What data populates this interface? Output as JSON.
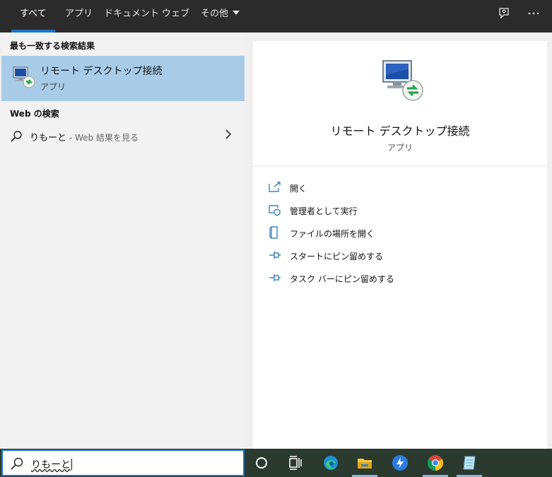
{
  "tabs": [
    {
      "label": "すべて",
      "active": true
    },
    {
      "label": "アプリ",
      "active": false
    },
    {
      "label": "ドキュメント",
      "active": false
    },
    {
      "label": "ウェブ",
      "active": false
    },
    {
      "label": "その他",
      "active": false
    }
  ],
  "topbar_icons": [
    "feedback-icon",
    "more-options-icon"
  ],
  "best_match": {
    "header": "最も一致する検索結果",
    "title": "リモート デスクトップ接続",
    "subtitle": "アプリ",
    "icon": "remote-desktop-icon"
  },
  "web_search": {
    "header": "Web の検索",
    "query": "りもーと",
    "suffix": " - Web 結果を見る"
  },
  "detail": {
    "title": "リモート デスクトップ接続",
    "subtitle": "アプリ",
    "actions": [
      {
        "label": "開く",
        "icon": "open-icon"
      },
      {
        "label": "管理者として実行",
        "icon": "run-as-admin-icon"
      },
      {
        "label": "ファイルの場所を開く",
        "icon": "file-location-icon"
      },
      {
        "label": "スタートにピン留めする",
        "icon": "pin-icon"
      },
      {
        "label": "タスク バーにピン留めする",
        "icon": "pin-icon"
      }
    ]
  },
  "searchbox": {
    "value": "りもーと"
  },
  "taskbar": {
    "items": [
      "cortana-icon",
      "task-view-icon",
      "edge-icon",
      "file-explorer-icon",
      "app-bolt-icon",
      "chrome-icon",
      "notepad-icon"
    ],
    "active_indicator_color": "#8fb5d8"
  },
  "colors": {
    "accent": "#1a73c9",
    "selected": "#a8cce8",
    "action_icon": "#1a6fb5"
  }
}
